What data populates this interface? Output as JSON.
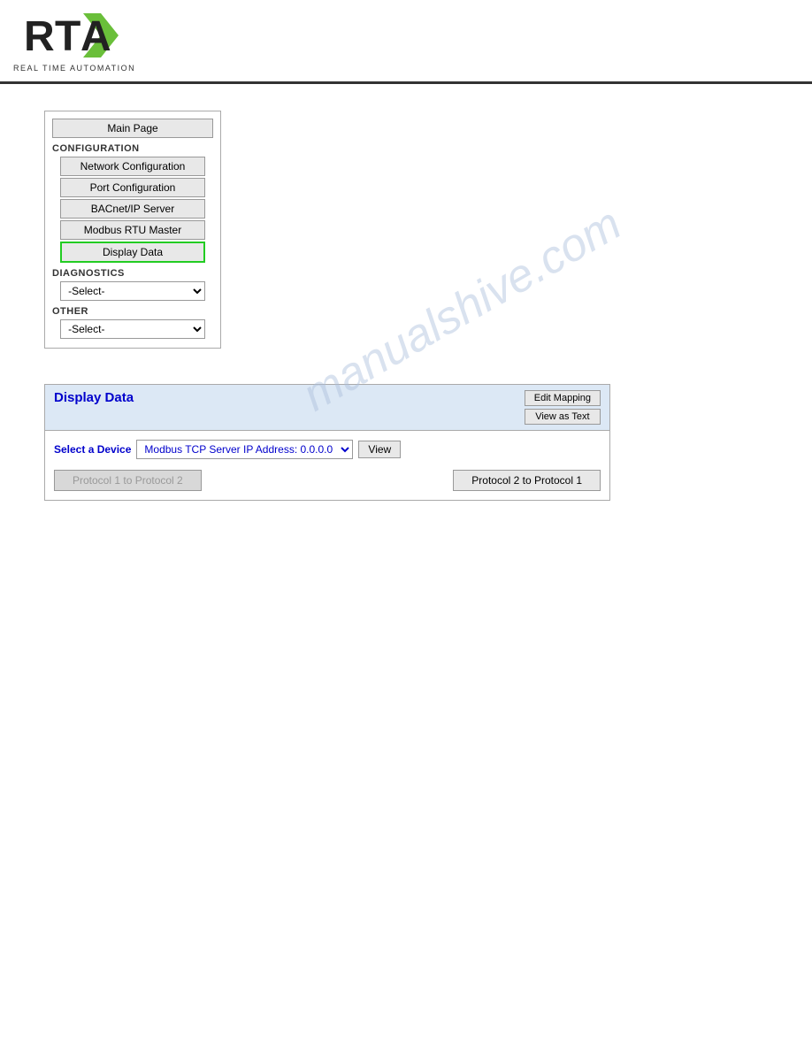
{
  "header": {
    "logo_alt": "RTA Logo",
    "tagline": "REAL TIME AUTOMATION"
  },
  "watermark": {
    "text": "manualshive.com"
  },
  "nav": {
    "main_page_label": "Main Page",
    "configuration_label": "CONFIGURATION",
    "config_items": [
      {
        "id": "network-config",
        "label": "Network Configuration",
        "active": false
      },
      {
        "id": "port-config",
        "label": "Port Configuration",
        "active": false
      },
      {
        "id": "bacnet-server",
        "label": "BACnet/IP Server",
        "active": false
      },
      {
        "id": "modbus-master",
        "label": "Modbus RTU Master",
        "active": false
      },
      {
        "id": "display-data",
        "label": "Display Data",
        "active": true
      }
    ],
    "diagnostics_label": "DIAGNOSTICS",
    "diagnostics_select_default": "-Select-",
    "other_label": "OTHER",
    "other_select_default": "-Select-"
  },
  "display_data": {
    "title": "Display Data",
    "edit_mapping_label": "Edit Mapping",
    "view_as_text_label": "View as Text",
    "select_device_label": "Select a Device",
    "device_options": [
      "Modbus TCP Server IP Address: 0.0.0.0"
    ],
    "device_selected": "Modbus TCP Server IP Address: 0.0.0.0",
    "view_btn_label": "View",
    "proto1_to_proto2_label": "Protocol 1 to Protocol 2",
    "proto2_to_proto1_label": "Protocol 2 to Protocol 1"
  }
}
